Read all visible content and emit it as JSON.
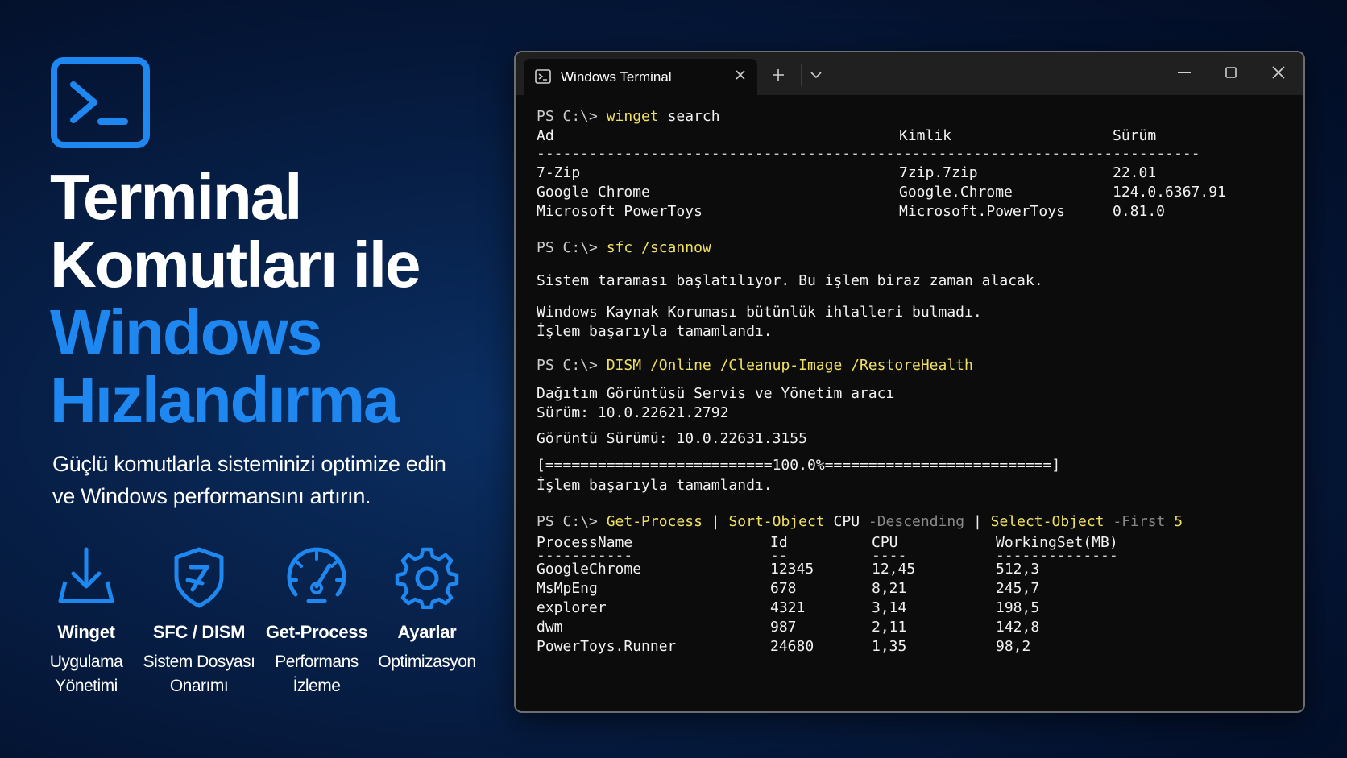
{
  "hero": {
    "icon": "terminal-prompt-icon",
    "title_lines": [
      "Terminal",
      "Komutları ile",
      "Windows",
      "Hızlandırma"
    ],
    "subtitle_lines": [
      "Güçlü komutlarla sisteminizi optimize edin",
      "ve Windows performansını artırın."
    ],
    "accent_color": "#1e88f0"
  },
  "features": [
    {
      "icon": "download-icon",
      "title": "Winget",
      "desc": [
        "Uygulama",
        "Yönetimi"
      ]
    },
    {
      "icon": "shield-icon",
      "title": "SFC / DISM",
      "desc": [
        "Sistem Dosyası",
        "Onarımı"
      ]
    },
    {
      "icon": "speedometer-icon",
      "title": "Get-Process",
      "desc": [
        "Performans",
        "İzleme"
      ]
    },
    {
      "icon": "gear-icon",
      "title": "Ayarlar",
      "desc": [
        "Optimizasyon"
      ]
    }
  ],
  "terminal": {
    "tab_title": "Windows Terminal",
    "prompt": "PS C:\\>",
    "winget": {
      "cmd_main": "winget",
      "cmd_arg": "search",
      "headers": [
        "Ad",
        "Kimlik",
        "Sürüm"
      ],
      "separator": "----------------------------------------------------------------------------",
      "rows": [
        [
          "7-Zip",
          "7zip.7zip",
          "22.01"
        ],
        [
          "Google Chrome",
          "Google.Chrome",
          "124.0.6367.91"
        ],
        [
          "Microsoft PowerToys",
          "Microsoft.PowerToys",
          "0.81.0"
        ]
      ]
    },
    "sfc": {
      "cmd": "sfc /scannow",
      "line1": "Sistem taraması başlatılıyor. Bu işlem biraz zaman alacak.",
      "line2": "Windows Kaynak Koruması bütünlük ihlalleri bulmadı.",
      "line3": "İşlem başarıyla tamamlandı."
    },
    "dism": {
      "cmd": "DISM /Online /Cleanup-Image /RestoreHealth",
      "line1": "Dağıtım Görüntüsü Servis ve Yönetim aracı",
      "line2": "Sürüm: 10.0.22621.2792",
      "line3": "Görüntü Sürümü: 10.0.22631.3155",
      "progress_text": "[==========================100.0%==========================]",
      "progress_percent": 100.0,
      "line4": "İşlem başarıyla tamamlandı."
    },
    "getprocess": {
      "cmd_parts": [
        "Get-Process",
        "|",
        "Sort-Object",
        "CPU",
        "-Descending",
        "|",
        "Select-Object",
        "-First",
        "5"
      ],
      "headers": [
        "ProcessName",
        "Id",
        "CPU",
        "WorkingSet(MB)"
      ],
      "underlines": [
        "-----------",
        "--",
        "----",
        "--------------"
      ],
      "rows": [
        [
          "GoogleChrome",
          "12345",
          "12,45",
          "512,3"
        ],
        [
          "MsMpEng",
          "678",
          "8,21",
          "245,7"
        ],
        [
          "explorer",
          "4321",
          "3,14",
          "198,5"
        ],
        [
          "dwm",
          "987",
          "2,11",
          "142,8"
        ],
        [
          "PowerToys.Runner",
          "24680",
          "1,35",
          "98,2"
        ]
      ]
    }
  }
}
